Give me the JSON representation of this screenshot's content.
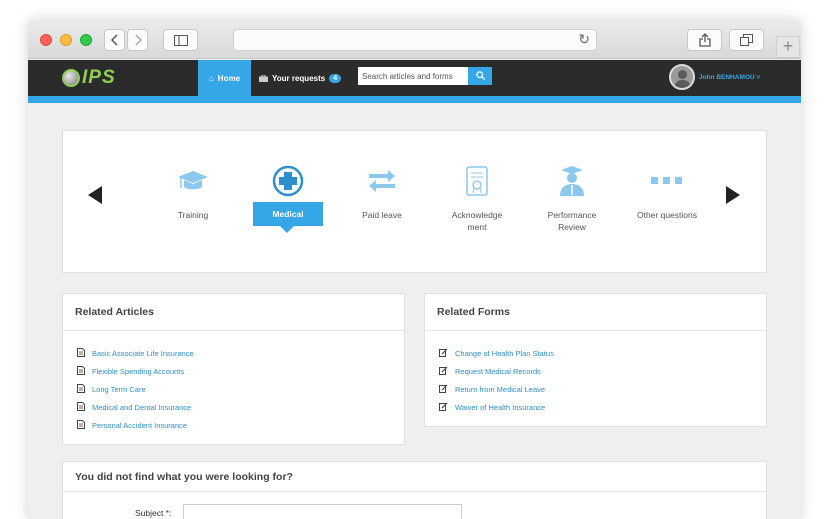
{
  "navbar": {
    "logo_text": "IPS",
    "home_label": "Home",
    "requests_label": "Your requests",
    "requests_count": "4",
    "search_placeholder": "Search articles and forms",
    "user_name": "John BENHAMOU ˅"
  },
  "categories": [
    {
      "label": "Training",
      "icon": "graduation-cap-icon",
      "active": false
    },
    {
      "label": "Medical",
      "icon": "medical-cross-icon",
      "active": true
    },
    {
      "label": "Paid leave",
      "icon": "exchange-arrows-icon",
      "active": false
    },
    {
      "label": "Acknowledge ment",
      "icon": "certificate-icon",
      "active": false
    },
    {
      "label": "Performance Review",
      "icon": "graduate-person-icon",
      "active": false
    },
    {
      "label": "Other questions",
      "icon": "more-dots-icon",
      "active": false
    }
  ],
  "related_articles": {
    "title": "Related Articles",
    "items": [
      "Basic Associate Life Insurance",
      "Flexible Spending Accounts",
      "Long Term Care",
      "Medical and Dental Insurance",
      "Personal Accident Insurance"
    ]
  },
  "related_forms": {
    "title": "Related Forms",
    "items": [
      "Change of Health Plan Status",
      "Request Medical Records",
      "Return from Medical Leave",
      "Waiver of Health Insurance"
    ]
  },
  "not_found": {
    "title": "You did not find what you were looking for?",
    "subject_label": "Subject *:",
    "subject_value": ""
  },
  "colors": {
    "accent": "#35a6e6",
    "nav_bg": "#2b2b2b",
    "logo_green": "#8fd14f",
    "icon_blue": "#8cc7ee"
  }
}
